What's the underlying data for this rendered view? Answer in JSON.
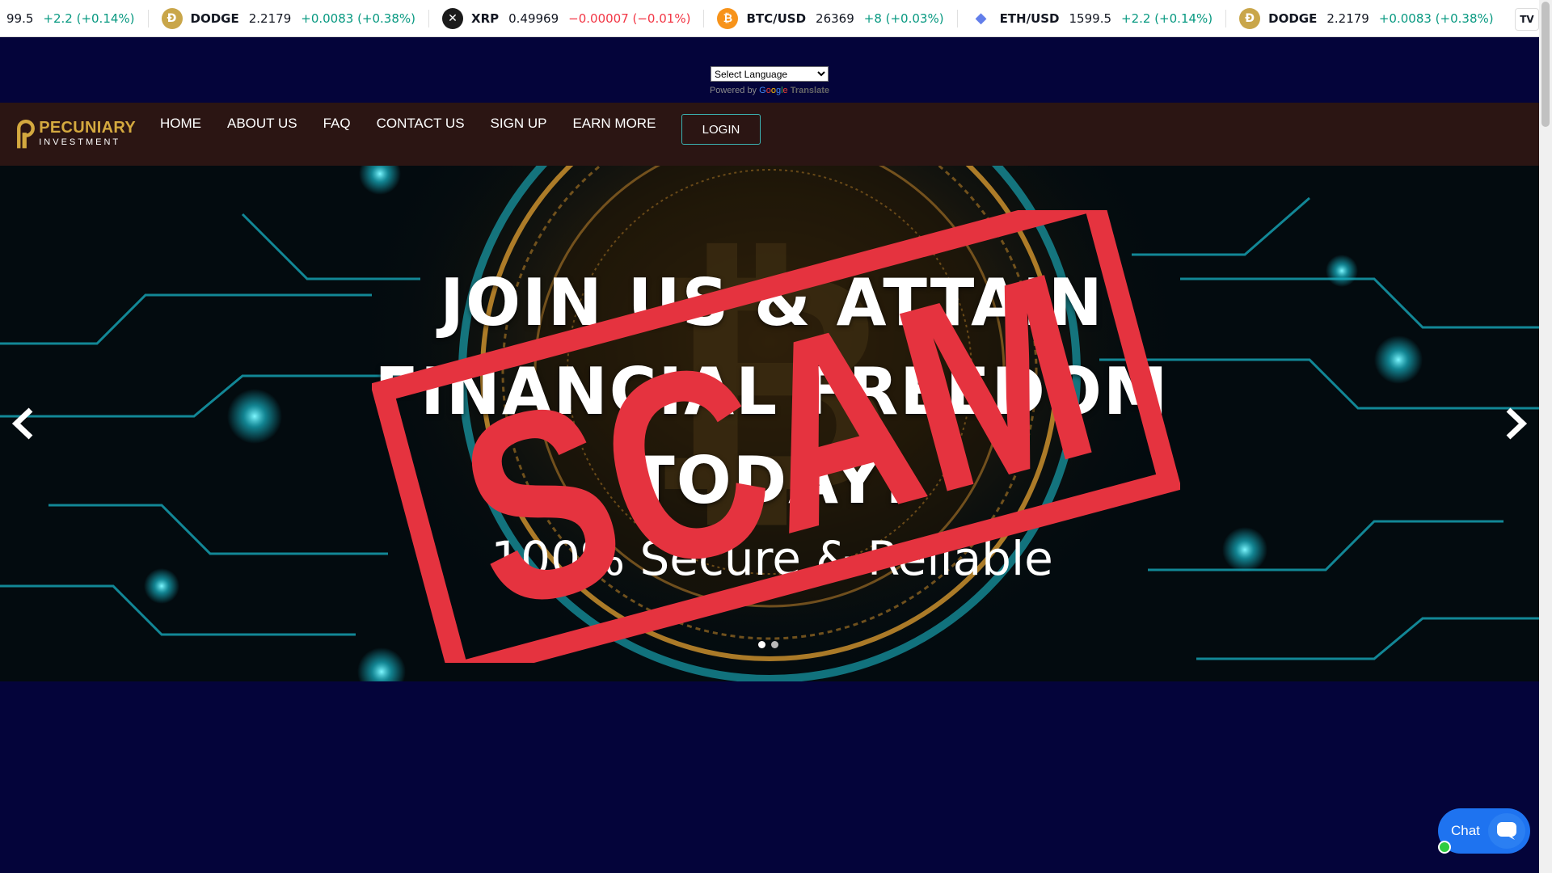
{
  "ticker": {
    "items": [
      {
        "symbol": "",
        "price": "99.5",
        "change": "+2.2 (+0.14%)",
        "direction": "up",
        "icon": "none"
      },
      {
        "symbol": "DODGE",
        "price": "2.2179",
        "change": "+0.0083 (+0.38%)",
        "direction": "up",
        "icon": "doge-coin-icon"
      },
      {
        "symbol": "XRP",
        "price": "0.49969",
        "change": "−0.00007 (−0.01%)",
        "direction": "down",
        "icon": "xrp-icon"
      },
      {
        "symbol": "BTC/USD",
        "price": "26369",
        "change": "+8 (+0.03%)",
        "direction": "up",
        "icon": "bitcoin-icon"
      },
      {
        "symbol": "ETH/USD",
        "price": "1599.5",
        "change": "+2.2 (+0.14%)",
        "direction": "up",
        "icon": "ethereum-icon"
      },
      {
        "symbol": "DODGE",
        "price": "2.2179",
        "change": "+0.0083 (+0.38%)",
        "direction": "up",
        "icon": "doge-coin-icon"
      }
    ],
    "widget_logo": "TV"
  },
  "translate": {
    "select_value": "Select Language",
    "powered_by": "Powered by",
    "google": "Google",
    "translate_word": "Translate"
  },
  "nav": {
    "logo_title": "PECUNIARY",
    "logo_subtitle": "INVESTMENT",
    "links": [
      "HOME",
      "ABOUT US",
      "FAQ",
      "CONTACT US",
      "SIGN UP",
      "EARN MORE"
    ],
    "login_label": "LOGIN"
  },
  "hero": {
    "heading_line1": "JOIN US & ATTAIN",
    "heading_line2": "FINANCIAL FREEDOM",
    "heading_line3": "TODAY!",
    "subheading": "100% Secure & Reliable",
    "slide_count": 2,
    "active_slide": 1
  },
  "stamp": {
    "text": "SCAM",
    "color": "#e5333f"
  },
  "chat": {
    "label": "Chat",
    "online": true
  },
  "colors": {
    "page_bg": "#04043a",
    "nav_bg": "#2b1513",
    "logo_gold": "#d4a93f",
    "ticker_up": "#089981",
    "ticker_down": "#f23645",
    "chat_blue": "#1e73f0",
    "login_border": "#3bb3b3"
  }
}
